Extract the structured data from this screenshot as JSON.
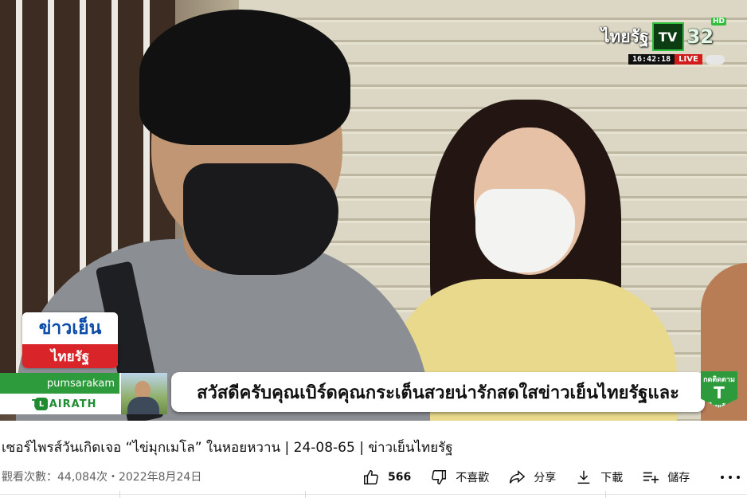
{
  "video": {
    "channel_logo_text": "ไทยรัฐ",
    "channel_tv": "TV",
    "channel_number": "32",
    "hd_badge": "HD",
    "clock": "16:42:18",
    "live_label": "LIVE",
    "program_badge_top": "ข่าวเย็น",
    "program_badge_bottom": "ไทยรัฐ",
    "reporter_name": "pumsarakam",
    "reporter_brand": "THAIRATH",
    "subtitle": "สวัสดีครับคุณเบิร์ดคุณกระเต็นสวยน่ารักสดใสข่าวเย็นไทยรัฐและ",
    "follow_label": "กดติดตาม",
    "follow_sub": "ไทยรัฐ"
  },
  "title": "เซอร์ไพรส์วันเกิดเจอ “ไข่มุกเมโล” ในหอยหวาน | 24-08-65 | ข่าวเย็นไทยรัฐ",
  "views": "觀看次數：44,084次・2022年8月24日",
  "actions": {
    "like_count": "566",
    "dislike_label": "不喜歡",
    "share_label": "分享",
    "download_label": "下載",
    "save_label": "儲存"
  },
  "icons": {
    "like": "thumbs-up-icon",
    "dislike": "thumbs-down-icon",
    "share": "share-arrow-icon",
    "download": "download-icon",
    "save": "playlist-add-icon",
    "more": "more-horizontal-icon"
  },
  "colors": {
    "accent_green": "#2d9b3c",
    "live_red": "#d21b1b",
    "program_blue": "#0b4aa8"
  }
}
